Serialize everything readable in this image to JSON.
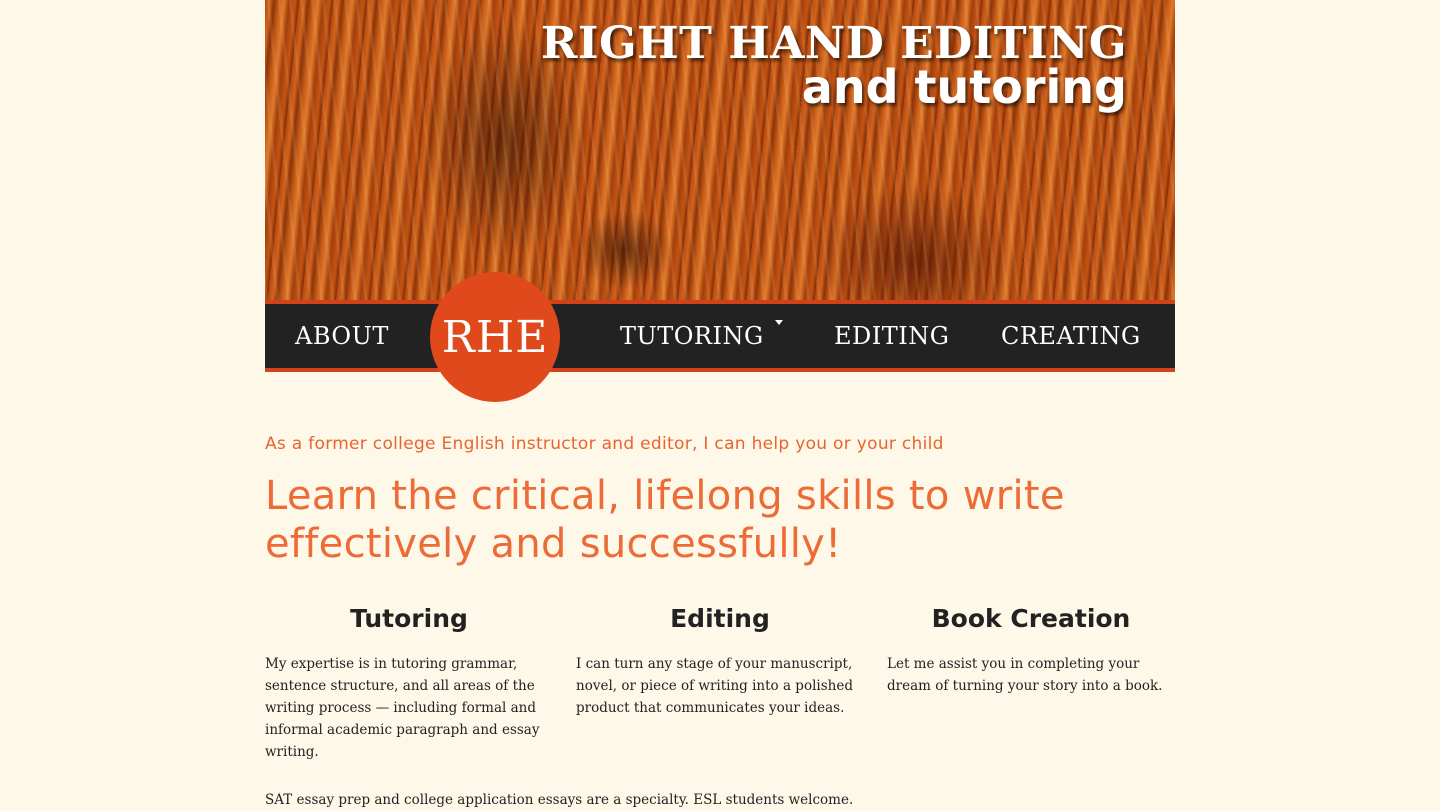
{
  "header": {
    "title": "RIGHT HAND EDITING",
    "subtitle": "and tutoring"
  },
  "nav": {
    "about": "ABOUT",
    "logo": "RHE",
    "tutoring": "TUTORING",
    "editing": "EDITING",
    "creating": "CREATING"
  },
  "main": {
    "intro": "As a former college English instructor and editor, I can help you or your child",
    "headline": "Learn the critical, lifelong skills to write effectively and successfully!",
    "columns": [
      {
        "title": "Tutoring",
        "text": "My expertise is in tutoring grammar, sentence structure, and all areas of the writing process — including formal and informal academic paragraph and essay writing."
      },
      {
        "title": "Editing",
        "text": "I can turn any stage of your manuscript, novel, or piece of writing into a polished product that communicates your ideas."
      },
      {
        "title": "Book Creation",
        "text": "Let me assist you in completing your dream of turning your story into a book."
      }
    ],
    "note": "SAT essay prep and college application essays are a specialty. ESL students welcome."
  },
  "colors": {
    "background": "#fef8e8",
    "accent": "#e0491c",
    "nav_bg": "#222222",
    "headline": "#ec6b37"
  },
  "icons": {
    "dropdown": "caret-down-icon"
  }
}
